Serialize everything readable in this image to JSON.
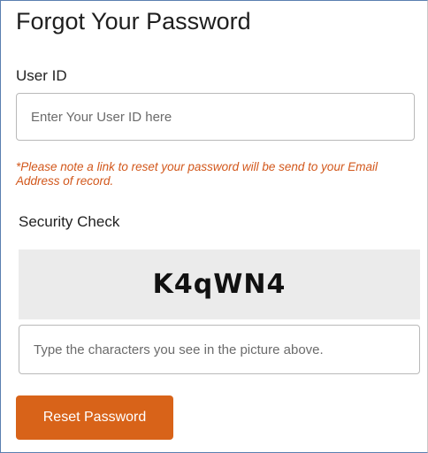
{
  "form": {
    "title": "Forgot Your Password",
    "user_id": {
      "label": "User ID",
      "placeholder": "Enter Your User ID here",
      "value": ""
    },
    "note": "*Please note a link to reset your password will be send to your Email Address of record.",
    "security_check": {
      "label": "Security Check",
      "captcha_text": "K4qWN4",
      "input_placeholder": "Type the characters you see in the picture above.",
      "input_value": ""
    },
    "submit_label": "Reset Password"
  },
  "colors": {
    "accent": "#d86319",
    "note_text": "#d2571b",
    "captcha_background": "#ebebeb",
    "panel_border": "#5b7fb0"
  }
}
